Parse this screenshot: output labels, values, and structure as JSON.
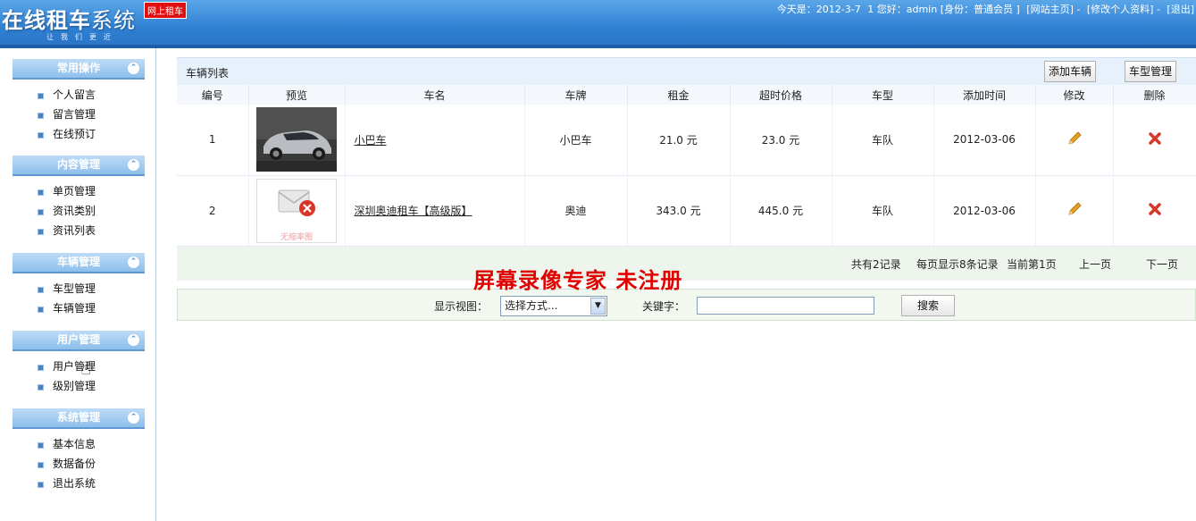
{
  "header": {
    "logo_bold": "在线租车",
    "logo_thin": "系统",
    "slogan": "让我们更近",
    "badge": "网上租车",
    "today": "今天是：2012-3-7",
    "greeting": "1 您好：admin [身份：普通会员 ]",
    "link_home": "[网站主页]",
    "link_profile": "[修改个人资料]",
    "link_logout": "[退出]"
  },
  "sidebar": {
    "groups": [
      {
        "title": "常用操作",
        "items": [
          "个人留言",
          "留言管理",
          "在线预订"
        ]
      },
      {
        "title": "内容管理",
        "items": [
          "单页管理",
          "资讯类别",
          "资讯列表"
        ]
      },
      {
        "title": "车辆管理",
        "items": [
          "车型管理",
          "车辆管理"
        ]
      },
      {
        "title": "用户管理",
        "items": [
          "用户管理",
          "级别管理"
        ]
      },
      {
        "title": "系统管理",
        "items": [
          "基本信息",
          "数据备份",
          "退出系统"
        ]
      }
    ],
    "toggle_glyph": "⌃"
  },
  "main": {
    "list_title": "车辆列表",
    "add_button": "添加车辆",
    "type_button": "车型管理",
    "columns": [
      "编号",
      "预览",
      "车名",
      "车牌",
      "租金",
      "超时价格",
      "车型",
      "添加时间",
      "修改",
      "删除"
    ],
    "rows": [
      {
        "id": "1",
        "name": "小巴车",
        "plate": "小巴车",
        "rent": "21.0 元",
        "overtime": "23.0 元",
        "type": "车队",
        "date": "2012-03-06",
        "thumb": "car-photo"
      },
      {
        "id": "2",
        "name": "深圳奥迪租车【高级版】",
        "plate": "奥迪",
        "rent": "343.0 元",
        "overtime": "445.0 元",
        "type": "车队",
        "date": "2012-03-06",
        "thumb": "no-image",
        "thumb_text": "无缩率图"
      }
    ],
    "pager": {
      "total": "共有2记录",
      "per_page": "每页显示8条记录",
      "current": "当前第1页",
      "prev": "上一页",
      "next": "下一页"
    },
    "search": {
      "view_label": "显示视图：",
      "select_value": "选择方式...",
      "keyword_label": "关键字：",
      "keyword_value": "",
      "button": "搜索"
    }
  },
  "watermark": "屏幕录像专家  未注册",
  "colors": {
    "header": "#2f7fd2",
    "edit_icon": "#e8a020",
    "delete_icon": "#d9362a",
    "watermark": "#e00000"
  }
}
